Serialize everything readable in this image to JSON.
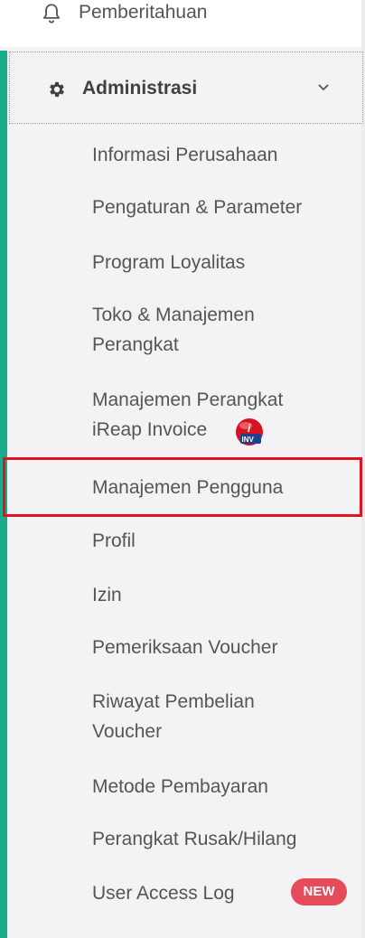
{
  "top_item": {
    "label": "Pemberitahuan",
    "icon": "bell-icon"
  },
  "group": {
    "title": "Administrasi",
    "icon": "gear-icon",
    "chevron": "chevron-down-icon",
    "accent_color": "#1aab8a"
  },
  "items": [
    {
      "line1": "Informasi Perusahaan"
    },
    {
      "line1": "Pengaturan & Parameter"
    },
    {
      "line1": "Program Loyalitas"
    },
    {
      "line1": "Toko & Manajemen",
      "line2": "Perangkat"
    },
    {
      "line1": "Manajemen Perangkat",
      "line2": "iReap Invoice",
      "badge_icon": "ireap-invoice-icon",
      "badge_text": "INV"
    },
    {
      "line1": "Manajemen Pengguna",
      "highlighted": true,
      "highlight_color": "#e0141e"
    },
    {
      "line1": "Profil"
    },
    {
      "line1": "Izin"
    },
    {
      "line1": "Pemeriksaan Voucher"
    },
    {
      "line1": "Riwayat Pembelian",
      "line2": "Voucher"
    },
    {
      "line1": "Metode Pembayaran"
    },
    {
      "line1": "Perangkat Rusak/Hilang"
    },
    {
      "line1": "User Access Log",
      "badge": "NEW",
      "badge_color": "#e54b58"
    }
  ]
}
